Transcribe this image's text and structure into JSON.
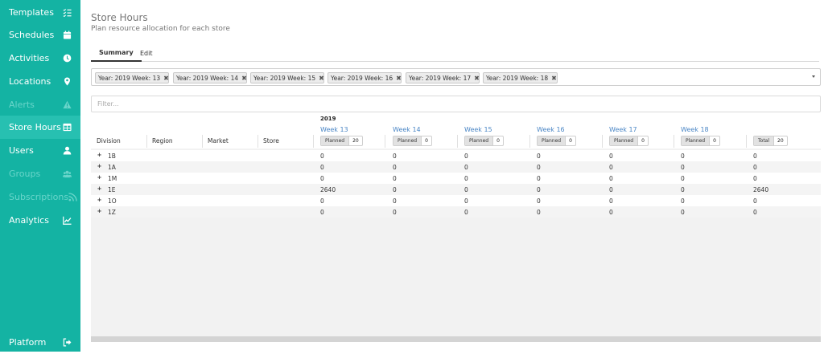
{
  "sidebar": {
    "items": [
      {
        "label": "Templates",
        "icon": "checklist-icon",
        "state": "normal"
      },
      {
        "label": "Schedules",
        "icon": "calendar-icon",
        "state": "normal"
      },
      {
        "label": "Activities",
        "icon": "clock-icon",
        "state": "normal"
      },
      {
        "label": "Locations",
        "icon": "map-pin-icon",
        "state": "normal"
      },
      {
        "label": "Alerts",
        "icon": "warning-icon",
        "state": "disabled"
      },
      {
        "label": "Store Hours",
        "icon": "table-icon",
        "state": "active"
      },
      {
        "label": "Users",
        "icon": "user-icon",
        "state": "normal"
      },
      {
        "label": "Groups",
        "icon": "group-icon",
        "state": "disabled"
      },
      {
        "label": "Subscriptions",
        "icon": "rss-icon",
        "state": "disabled"
      },
      {
        "label": "Analytics",
        "icon": "line-chart-icon",
        "state": "normal"
      }
    ],
    "footer": {
      "label": "Platform",
      "icon": "sign-out-icon"
    }
  },
  "header": {
    "title": "Store Hours",
    "subtitle": "Plan resource allocation for each store"
  },
  "tabs": [
    {
      "label": "Summary",
      "active": true
    },
    {
      "label": "Edit",
      "active": false
    }
  ],
  "week_selector": {
    "chips": [
      "Year: 2019 Week: 13",
      "Year: 2019 Week: 14",
      "Year: 2019 Week: 15",
      "Year: 2019 Week: 16",
      "Year: 2019 Week: 17",
      "Year: 2019 Week: 18"
    ],
    "remove_glyph": "✖"
  },
  "filter": {
    "placeholder": "Filter..."
  },
  "grid": {
    "year": "2019",
    "columns": [
      "Division",
      "Region",
      "Market",
      "Store"
    ],
    "weeks": [
      {
        "label": "Week 13",
        "metric_label": "Planned",
        "metric_value": "20"
      },
      {
        "label": "Week 14",
        "metric_label": "Planned",
        "metric_value": "0"
      },
      {
        "label": "Week 15",
        "metric_label": "Planned",
        "metric_value": "0"
      },
      {
        "label": "Week 16",
        "metric_label": "Planned",
        "metric_value": "0"
      },
      {
        "label": "Week 17",
        "metric_label": "Planned",
        "metric_value": "0"
      },
      {
        "label": "Week 18",
        "metric_label": "Planned",
        "metric_value": "0"
      }
    ],
    "total": {
      "metric_label": "Total",
      "metric_value": "20"
    },
    "expand_glyph": "+",
    "rows": [
      {
        "division": "1B",
        "values": [
          "0",
          "0",
          "0",
          "0",
          "0",
          "0",
          "0"
        ]
      },
      {
        "division": "1A",
        "values": [
          "0",
          "0",
          "0",
          "0",
          "0",
          "0",
          "0"
        ]
      },
      {
        "division": "1M",
        "values": [
          "0",
          "0",
          "0",
          "0",
          "0",
          "0",
          "0"
        ]
      },
      {
        "division": "1E",
        "values": [
          "2640",
          "0",
          "0",
          "0",
          "0",
          "0",
          "2640"
        ]
      },
      {
        "division": "1O",
        "values": [
          "0",
          "0",
          "0",
          "0",
          "0",
          "0",
          "0"
        ]
      },
      {
        "division": "1Z",
        "values": [
          "0",
          "0",
          "0",
          "0",
          "0",
          "0",
          "0"
        ]
      }
    ]
  },
  "colors": {
    "sidebar_bg": "#14b3a3",
    "sidebar_active_bg": "#27c0b1",
    "sidebar_disabled_text": "#69d5ca",
    "week_link": "#4a86c5"
  }
}
